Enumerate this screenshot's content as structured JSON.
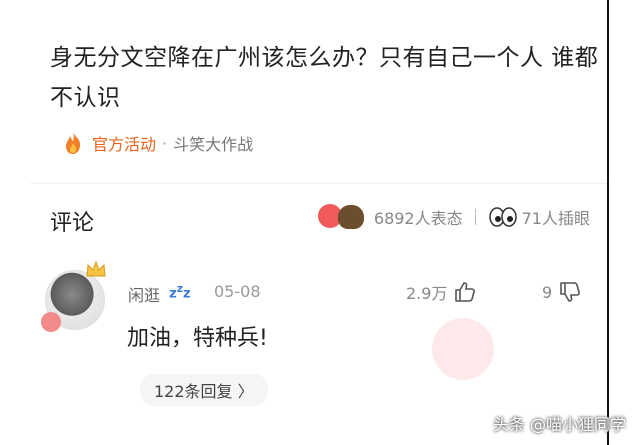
{
  "post": {
    "title": "身无分文空降在广州该怎么办？只有自己一个人  谁都不认识",
    "activity_label": "官方活动",
    "separator": "·",
    "topic": "斗笑大作战"
  },
  "comments_section": {
    "header": "评论",
    "reactions_count": "6892人表态",
    "eye_count": "71人插眼"
  },
  "comment": {
    "user_name": "闲逛",
    "status_icon": "zzz-icon",
    "date": "05-08",
    "likes": "2.9万",
    "dislikes": "9",
    "text": "加油，特种兵!",
    "replies_label": "122条回复 〉"
  },
  "watermark": "头条 @喵小狸同学",
  "colors": {
    "accent": "#e8641e",
    "text": "#222222",
    "muted": "#999999"
  }
}
